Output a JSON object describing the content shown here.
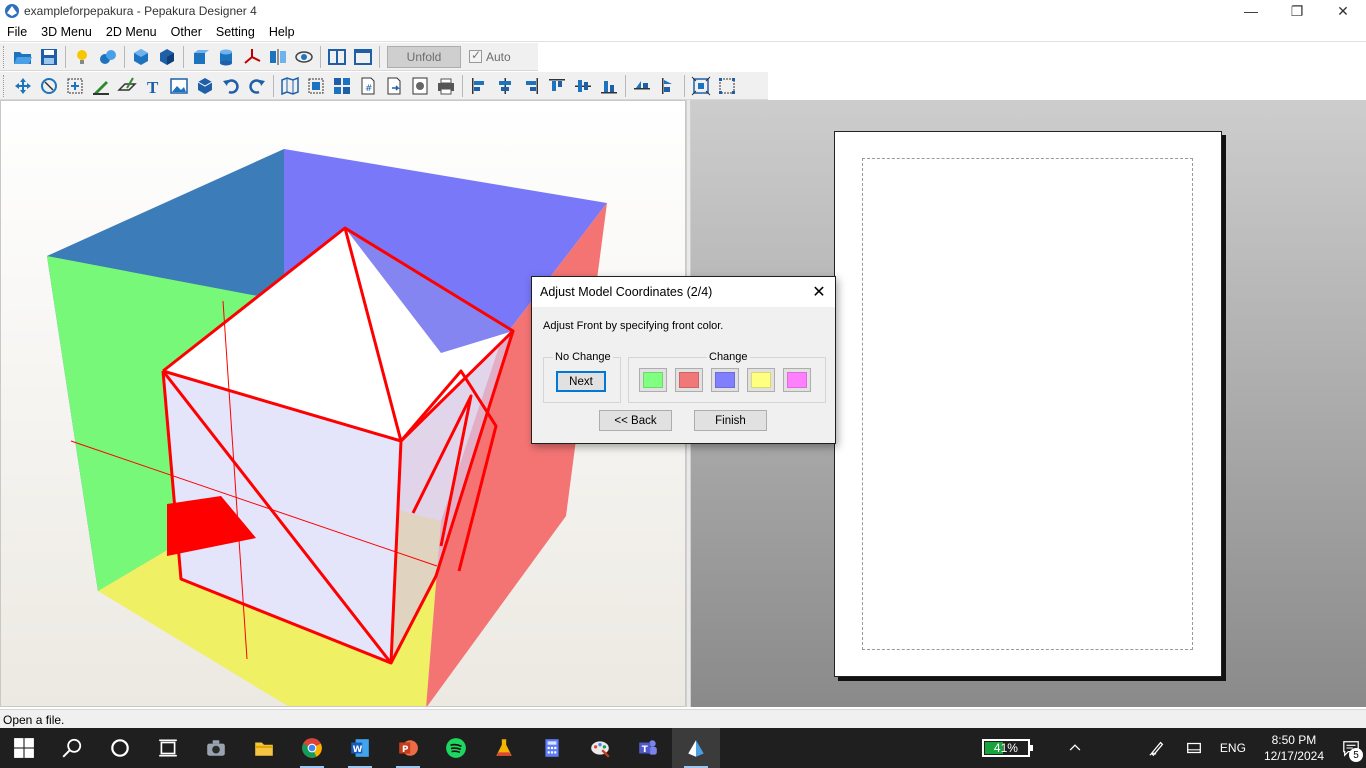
{
  "window": {
    "title": "exampleforpepakura - Pepakura Designer 4",
    "minimize_glyph": "—",
    "restore_glyph": "❐",
    "close_glyph": "✕"
  },
  "menu": [
    "File",
    "3D Menu",
    "2D Menu",
    "Other",
    "Setting",
    "Help"
  ],
  "toolbar": {
    "unfold_label": "Unfold",
    "auto_label": "Auto",
    "auto_checked": true,
    "unfold_enabled": false
  },
  "dialog": {
    "title": "Adjust Model Coordinates (2/4)",
    "close_glyph": "✕",
    "message": "Adjust Front by specifying front color.",
    "no_change_label": "No Change",
    "next_label": "Next",
    "change_label": "Change",
    "swatches": [
      "#80ff80",
      "#f07878",
      "#8080ff",
      "#ffff80",
      "#ff80ff"
    ],
    "back_label": "<< Back",
    "finish_label": "Finish"
  },
  "status_text": "Open a file.",
  "model_colors": {
    "left": "#78f878",
    "back": "#3c7cb8",
    "top_right": "#7878f8",
    "right": "#f47474",
    "bottom": "#f0f064",
    "wire": "#ff0000"
  },
  "taskbar": {
    "battery_percent": "41%",
    "battery_level": 0.41,
    "language": "ENG",
    "time": "8:50 PM",
    "date": "12/17/2024",
    "notification_count": "5"
  }
}
